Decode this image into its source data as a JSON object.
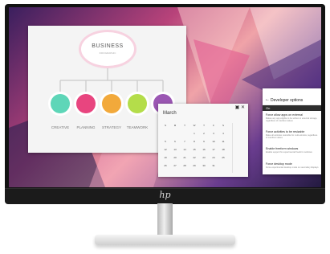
{
  "slide": {
    "title": "BUSINESS",
    "subtitle": "INFOGRAPHIC",
    "items": [
      {
        "label": "CREATIVE",
        "color": "#5ed6b8"
      },
      {
        "label": "PLANNING",
        "color": "#e8457f"
      },
      {
        "label": "STRATEGY",
        "color": "#f2a93b"
      },
      {
        "label": "TEAMWORK",
        "color": "#b4dd4a"
      },
      {
        "label": "SUCC",
        "color": "#9b57b3"
      }
    ]
  },
  "calendar": {
    "month": "March",
    "window_icons": "▣ ✕",
    "weekday_headers": [
      "S",
      "M",
      "T",
      "W",
      "T",
      "F",
      "S"
    ],
    "weeks": [
      [
        "",
        "",
        "",
        "1",
        "2",
        "3",
        "4"
      ],
      [
        "5",
        "6",
        "7",
        "8",
        "9",
        "10",
        "11"
      ],
      [
        "12",
        "13",
        "14",
        "15",
        "16",
        "17",
        "18"
      ],
      [
        "19",
        "20",
        "21",
        "22",
        "23",
        "24",
        "25"
      ],
      [
        "26",
        "27",
        "28",
        "29",
        "30",
        "31",
        ""
      ]
    ]
  },
  "developer_options": {
    "title": "Developer options",
    "back_icon": "←",
    "master_toggle": "On",
    "items": [
      {
        "title": "Force allow apps on external",
        "desc": "Makes any app eligible to be written to external storage, regardless of manifest values"
      },
      {
        "title": "Force activities to be resizable",
        "desc": "Make all activities resizable for multi-window, regardless of manifest values"
      },
      {
        "title": "Enable freeform windows",
        "desc": "Enable support for experimental freeform windows"
      },
      {
        "title": "Force desktop mode",
        "desc": "Force experimental desktop mode on secondary displays"
      }
    ]
  },
  "brand_logo": "hp"
}
